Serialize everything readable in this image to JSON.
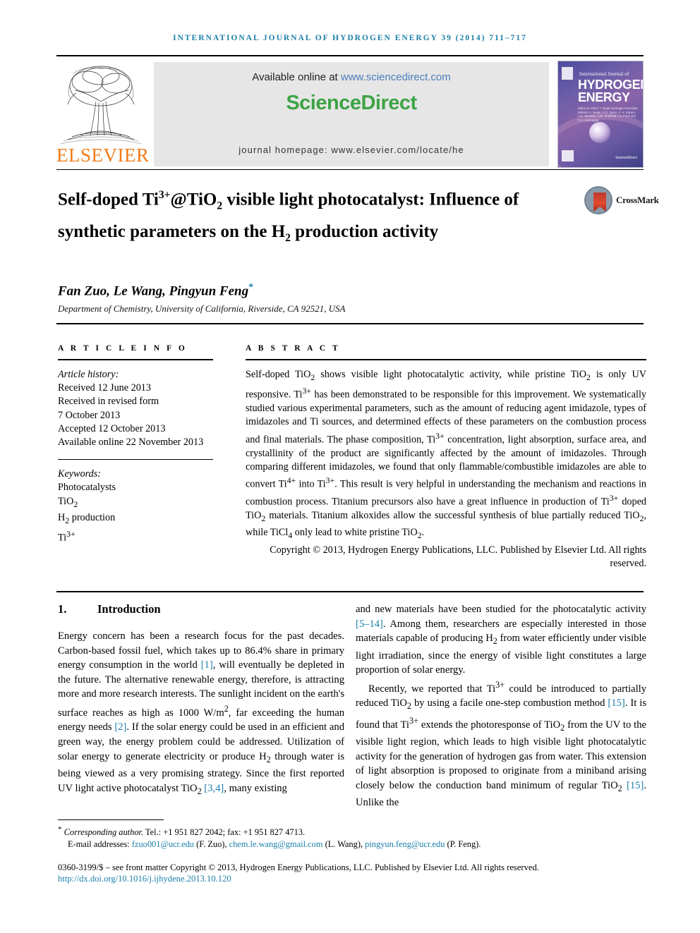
{
  "running_head": "International Journal of Hydrogen Energy 39 (2014) 711–717",
  "masthead": {
    "publisher": "ELSEVIER",
    "available_prefix": "Available online at ",
    "available_url": "www.sciencedirect.com",
    "sciencedirect_logo": "ScienceDirect",
    "journal_homepage": "journal homepage: www.elsevier.com/locate/he",
    "cover": {
      "top_label": "International Journal of",
      "line1": "HYDROGEN",
      "line2": "ENERGY",
      "editors": "Editor-in-Chief: T. Nejat Veziroglu   Associate Editors: A. Bejan, D.S. Dunn, A. A. Karam, A.E. Morales, J.W. Sheffield, I.a. Ford and C.A. Sminaglia",
      "sciencedirect_mark": "ScienceDirect"
    }
  },
  "article": {
    "title_html": "Self-doped Ti<sup>3+</sup>@TiO<sub>2</sub> visible light photocatalyst: Influence of synthetic parameters on the H<sub>2</sub> production activity",
    "authors": "Fan Zuo, Le Wang, Pingyun Feng",
    "author_footnote_marker": "*",
    "affiliation": "Department of Chemistry, University of California, Riverside, CA 92521, USA",
    "crossmark_label": "CrossMark"
  },
  "article_info": {
    "heading": "A R T I C L E  I N F O",
    "history_label": "Article history:",
    "history": [
      "Received 12 June 2013",
      "Received in revised form",
      "7 October 2013",
      "Accepted 12 October 2013",
      "Available online 22 November 2013"
    ],
    "keywords_label": "Keywords:",
    "keywords_html": [
      "Photocatalysts",
      "TiO<sub>2</sub>",
      "H<sub>2</sub> production",
      "Ti<sup>3+</sup>"
    ]
  },
  "abstract": {
    "heading": "A B S T R A C T",
    "body_html": "Self-doped TiO<sub>2</sub> shows visible light photocatalytic activity, while pristine TiO<sub>2</sub> is only UV responsive. Ti<sup>3+</sup> has been demonstrated to be responsible for this improvement. We systematically studied various experimental parameters, such as the amount of reducing agent imidazole, types of imidazoles and Ti sources, and determined effects of these parameters on the combustion process and final materials. The phase composition, Ti<sup>3+</sup> concentration, light absorption, surface area, and crystallinity of the product are significantly affected by the amount of imidazoles. Through comparing different imidazoles, we found that only flammable/combustible imidazoles are able to convert Ti<sup>4+</sup> into Ti<sup>3+</sup>. This result is very helpful in understanding the mechanism and reactions in combustion process. Titanium precursors also have a great influence in production of Ti<sup>3+</sup> doped TiO<sub>2</sub> materials. Titanium alkoxides allow the successful synthesis of blue partially reduced TiO<sub>2</sub>, while TiCl<sub>4</sub> only lead to white pristine TiO<sub>2</sub>.",
    "copyright_html": "Copyright © 2013, Hydrogen Energy Publications, LLC. Published by Elsevier Ltd. All rights reserved."
  },
  "introduction": {
    "number": "1.",
    "heading": "Introduction",
    "left_paragraph_html": "Energy concern has been a research focus for the past decades. Carbon-based fossil fuel, which takes up to 86.4% share in primary energy consumption in the world <span class=\"cite\">[1]</span>, will eventually be depleted in the future. The alternative renewable energy, therefore, is attracting more and more research interests. The sunlight incident on the earth's surface reaches as high as 1000 W/m<sup>2</sup>, far exceeding the human energy needs <span class=\"cite\">[2]</span>. If the solar energy could be used in an efficient and green way, the energy problem could be addressed. Utilization of solar energy to generate electricity or produce H<sub>2</sub> through water is being viewed as a very promising strategy. Since the first reported UV light active photocatalyst TiO<sub>2</sub> <span class=\"cite\">[3,4]</span>, many existing",
    "right_paragraph1_html": "and new materials have been studied for the photocatalytic activity <span class=\"cite\">[5–14]</span>. Among them, researchers are especially interested in those materials capable of producing H<sub>2</sub> from water efficiently under visible light irradiation, since the energy of visible light constitutes a large proportion of solar energy.",
    "right_paragraph2_html": "Recently, we reported that Ti<sup>3+</sup> could be introduced to partially reduced TiO<sub>2</sub> by using a facile one-step combustion method <span class=\"cite\">[15]</span>. It is found that Ti<sup>3+</sup> extends the photoresponse of TiO<sub>2</sub> from the UV to the visible light region, which leads to high visible light photocatalytic activity for the generation of hydrogen gas from water. This extension of light absorption is proposed to originate from a miniband arising closely below the conduction band minimum of regular TiO<sub>2</sub> <span class=\"cite\">[15]</span>. Unlike the"
  },
  "footer": {
    "corresponding_html": "<span class=\"star\">*</span> <i>Corresponding author.</i> Tel.: +1 951 827 2042; fax: +1 951 827 4713.",
    "emails_html": "E-mail addresses: <span class=\"link\">fzuo001@ucr.edu</span> (F. Zuo), <span class=\"link\">chem.le.wang@gmail.com</span> (L. Wang), <span class=\"link\">pingyun.feng@ucr.edu</span> (P. Feng).",
    "issn_html": "0360-3199/$ – see front matter Copyright © 2013, Hydrogen Energy Publications, LLC. Published by Elsevier Ltd. All rights reserved.",
    "doi": "http://dx.doi.org/10.1016/j.ijhydene.2013.10.120"
  },
  "colors": {
    "journal_blue": "#1a7fa8",
    "elsevier_orange": "#F07C18",
    "sciencedirect_green": "#3DA345",
    "link_blue": "#4a7ebb"
  }
}
